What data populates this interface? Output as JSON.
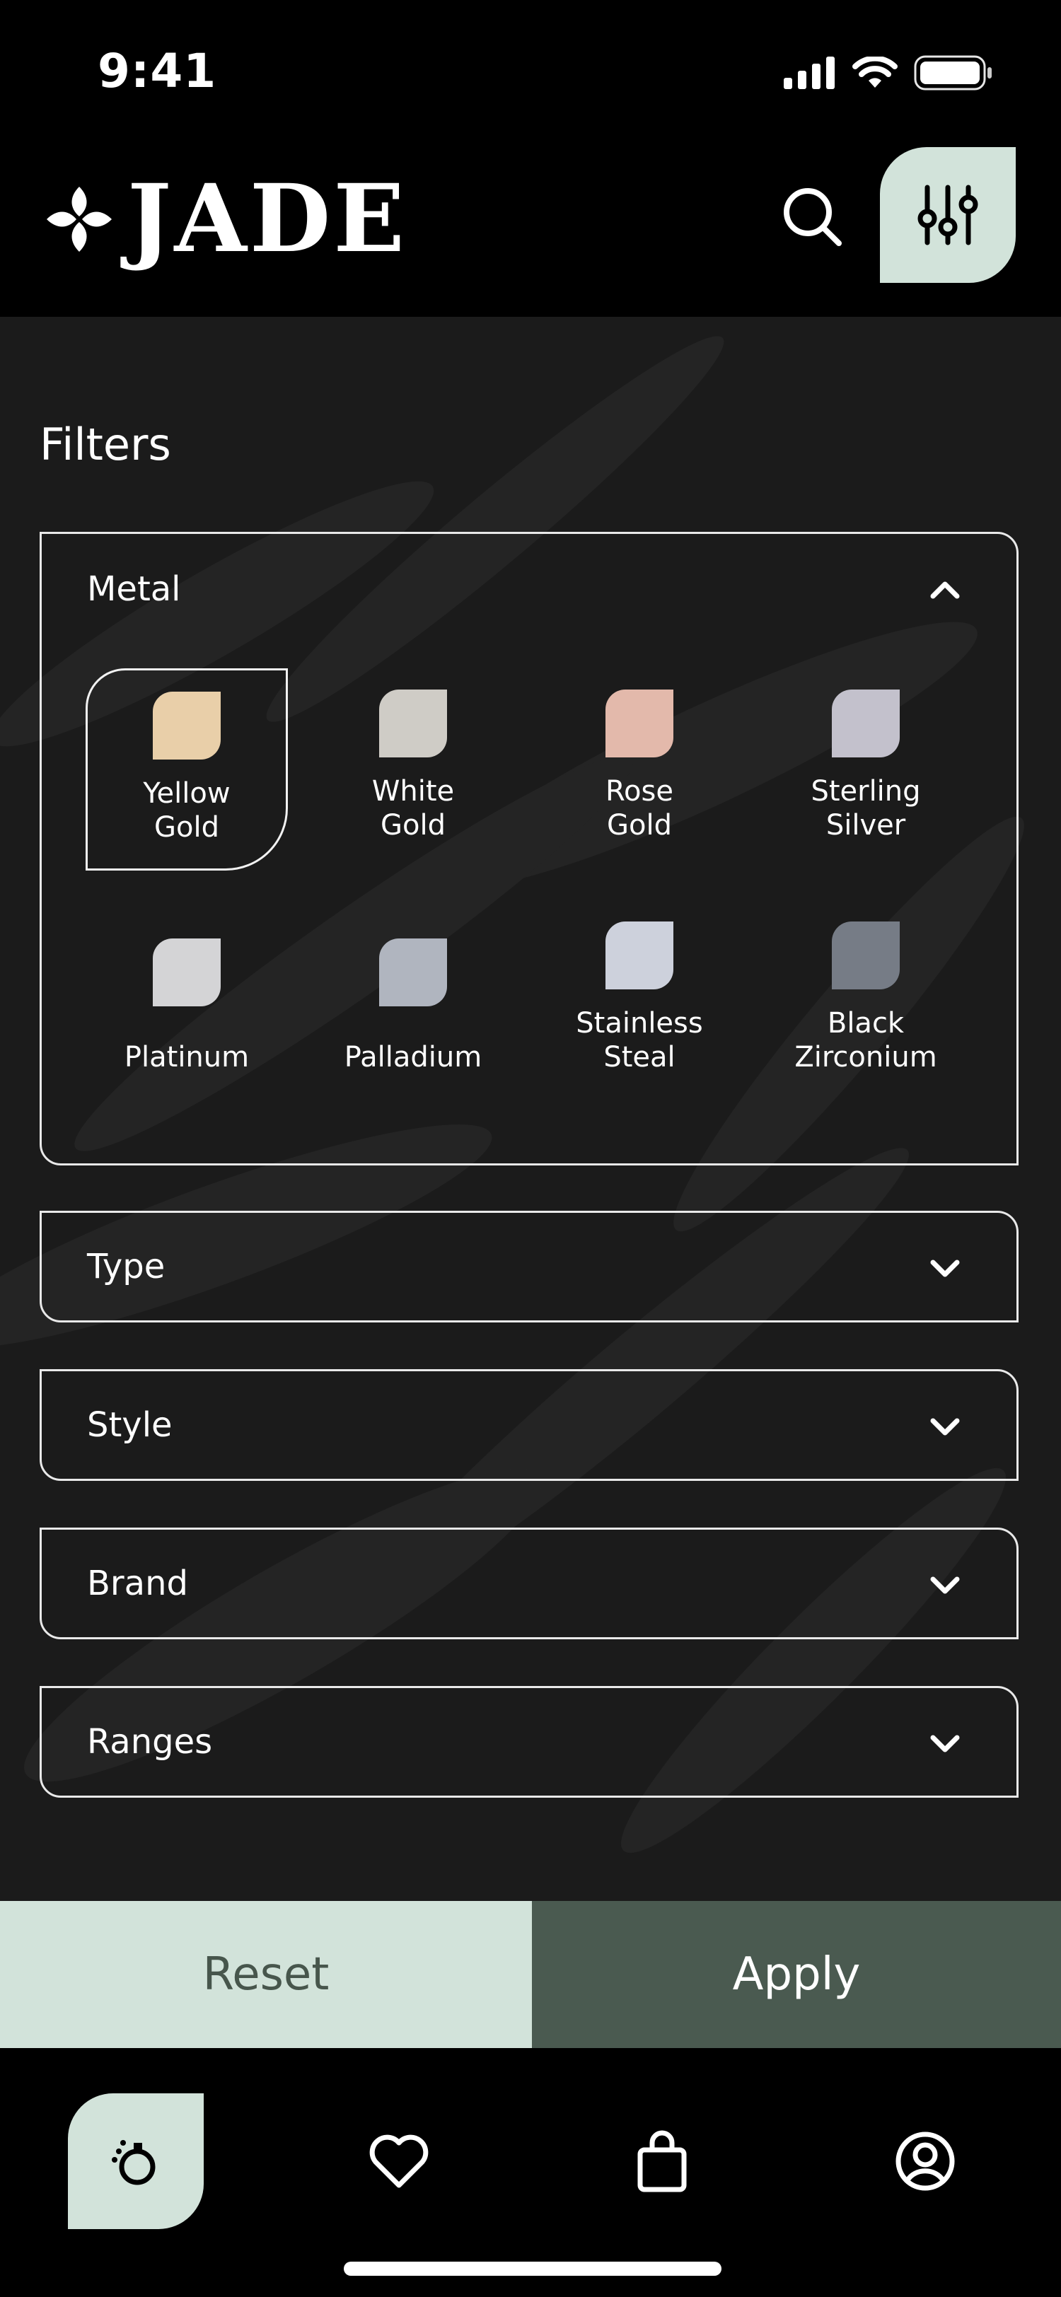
{
  "status_bar": {
    "time": "9:41"
  },
  "header": {
    "brand": "JADE"
  },
  "page": {
    "title": "Filters"
  },
  "metal": {
    "label": "Metal",
    "options": [
      {
        "line1": "Yellow",
        "line2": "Gold",
        "color": "#e9cfa9",
        "selected": true
      },
      {
        "line1": "White",
        "line2": "Gold",
        "color": "#cfccc6",
        "selected": false
      },
      {
        "line1": "Rose",
        "line2": "Gold",
        "color": "#e3b9ab",
        "selected": false
      },
      {
        "line1": "Sterling",
        "line2": "Silver",
        "color": "#c3c1cc",
        "selected": false
      },
      {
        "line1": "Platinum",
        "line2": "",
        "color": "#d4d4d6",
        "selected": false
      },
      {
        "line1": "Palladium",
        "line2": "",
        "color": "#b0b5bf",
        "selected": false
      },
      {
        "line1": "Stainless",
        "line2": "Steal",
        "color": "#cdd1dc",
        "selected": false
      },
      {
        "line1": "Black",
        "line2": "Zirconium",
        "color": "#767c86",
        "selected": false
      }
    ]
  },
  "sections": [
    {
      "label": "Type"
    },
    {
      "label": "Style"
    },
    {
      "label": "Brand"
    },
    {
      "label": "Ranges"
    }
  ],
  "actions": {
    "reset": "Reset",
    "apply": "Apply"
  },
  "colors": {
    "accent_light": "#d2e3da",
    "accent_dark": "#4a5a50",
    "background": "#1b1b1b"
  },
  "tabbar": {
    "items": [
      "ring-icon",
      "heart-icon",
      "bag-icon",
      "profile-icon"
    ]
  }
}
